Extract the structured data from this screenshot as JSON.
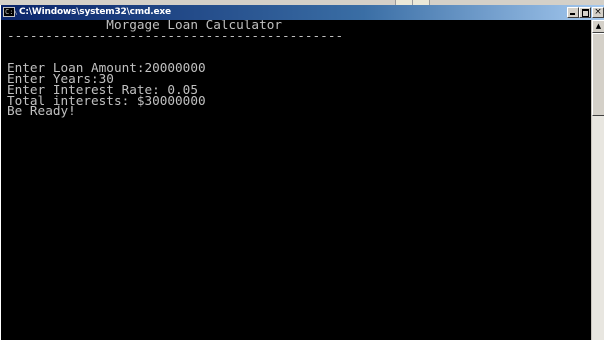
{
  "window": {
    "title": "C:\\Windows\\system32\\cmd.exe",
    "icon_text": "C:\\",
    "controls": {
      "minimize": "_",
      "maximize": "□",
      "close": "×"
    }
  },
  "console": {
    "lines": [
      "             Morgage Loan Calculator",
      "--------------------------------------------",
      "",
      "",
      "Enter Loan Amount:20000000",
      "Enter Years:30",
      "Enter Interest Rate: 0.05",
      "Total interests: $30000000",
      "Be Ready!"
    ]
  },
  "scrollbar": {
    "up_arrow": "▲"
  },
  "colors": {
    "console_bg": "#000000",
    "console_text": "#c0c0c0",
    "titlebar_start": "#0a246a",
    "titlebar_end": "#a6caf0"
  }
}
